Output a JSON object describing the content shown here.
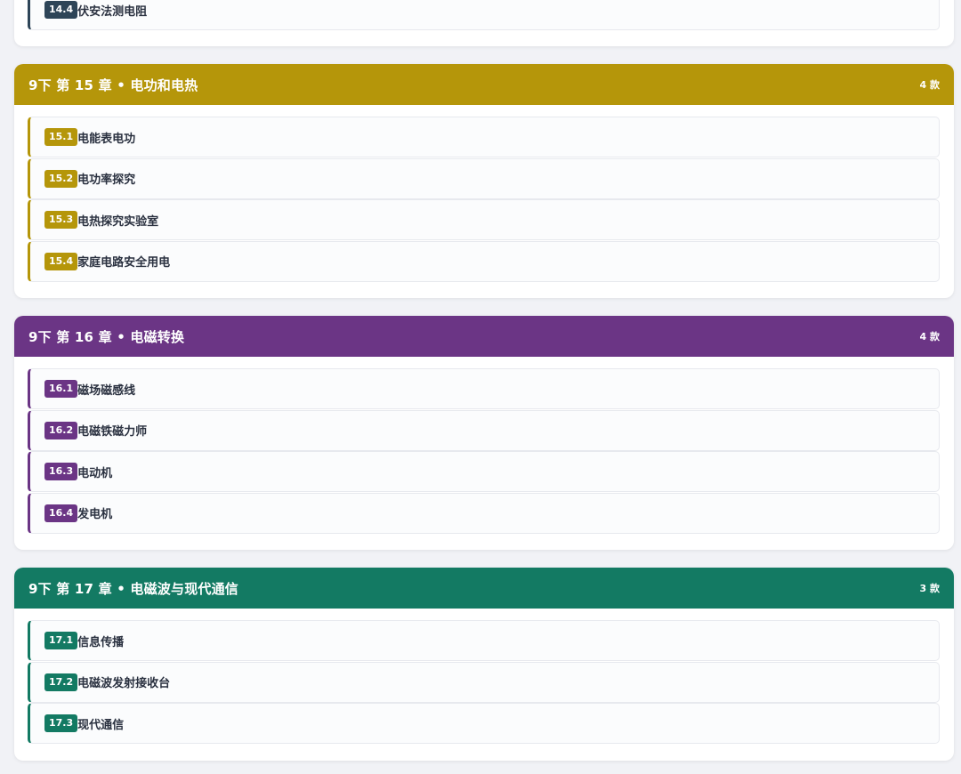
{
  "sections": [
    {
      "title": "",
      "count": "",
      "color": "#2e4558",
      "items": [
        {
          "num": "14.4",
          "label": "伏安法测电阻"
        }
      ]
    },
    {
      "title": "9下 第 15 章 • 电功和电热",
      "count": "4 款",
      "color": "#b5960a",
      "items": [
        {
          "num": "15.1",
          "label": "电能表电功"
        },
        {
          "num": "15.2",
          "label": "电功率探究"
        },
        {
          "num": "15.3",
          "label": "电热探究实验室"
        },
        {
          "num": "15.4",
          "label": "家庭电路安全用电"
        }
      ]
    },
    {
      "title": "9下 第 16 章 • 电磁转换",
      "count": "4 款",
      "color": "#6b3585",
      "items": [
        {
          "num": "16.1",
          "label": "磁场磁感线"
        },
        {
          "num": "16.2",
          "label": "电磁铁磁力师"
        },
        {
          "num": "16.3",
          "label": "电动机"
        },
        {
          "num": "16.4",
          "label": "发电机"
        }
      ]
    },
    {
      "title": "9下 第 17 章 • 电磁波与现代通信",
      "count": "3 款",
      "color": "#137a63",
      "items": [
        {
          "num": "17.1",
          "label": "信息传播"
        },
        {
          "num": "17.2",
          "label": "电磁波发射接收台"
        },
        {
          "num": "17.3",
          "label": "现代通信"
        }
      ]
    }
  ]
}
